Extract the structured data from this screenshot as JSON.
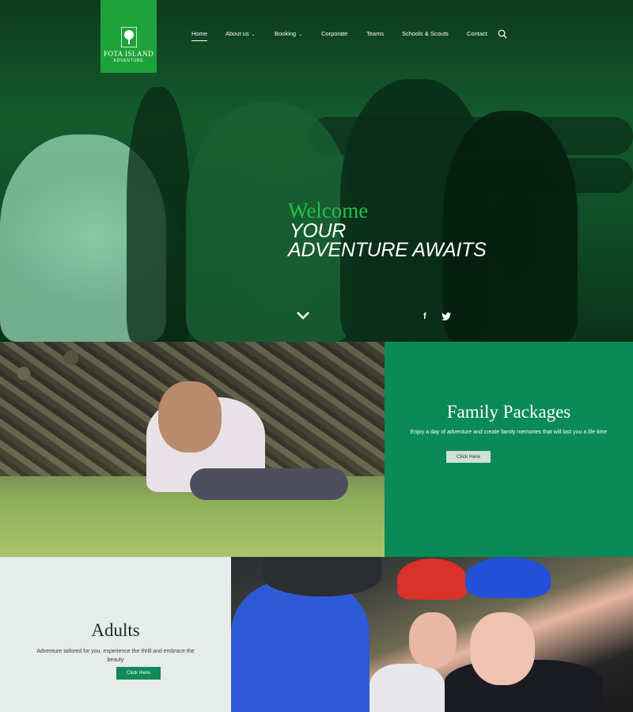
{
  "logo": {
    "line1": "FOTA ISLAND",
    "line2": "ADVENTURE"
  },
  "nav": {
    "items": [
      {
        "label": "Home",
        "active": true,
        "dropdown": false
      },
      {
        "label": "About us",
        "active": false,
        "dropdown": true
      },
      {
        "label": "Booking",
        "active": false,
        "dropdown": true
      },
      {
        "label": "Corporate",
        "active": false,
        "dropdown": false
      },
      {
        "label": "Teams",
        "active": false,
        "dropdown": false
      },
      {
        "label": "Schools & Scouts",
        "active": false,
        "dropdown": false
      },
      {
        "label": "Contact",
        "active": false,
        "dropdown": false
      }
    ],
    "search_icon": "search-icon"
  },
  "hero": {
    "welcome": "Welcome",
    "tagline_line1": "YOUR",
    "tagline_line2": "ADVENTURE AWAITS",
    "scroll_icon": "chevron-down-icon",
    "social": [
      "facebook-icon",
      "twitter-icon"
    ],
    "facebook_glyph": "f"
  },
  "family": {
    "title": "Family Packages",
    "description": "Enjoy a day of adventure and create family memories that will last you a life time",
    "button": "Click Here"
  },
  "adults": {
    "title": "Adults",
    "description": "Adventure tailored for you, experience the thrill and embrace the beauty",
    "button": "Click Here"
  },
  "colors": {
    "brand_green": "#1ea33b",
    "panel_green": "#098a58",
    "welcome_green": "#22c24b",
    "adults_bg": "#e6ece9"
  }
}
